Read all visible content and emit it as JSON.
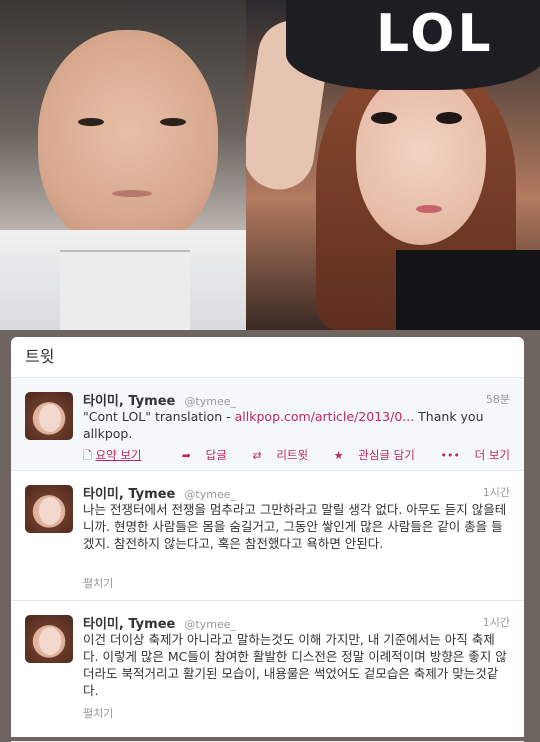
{
  "panel": {
    "title": "트윗"
  },
  "photos": {
    "cap_text": "LOL"
  },
  "tweets": [
    {
      "name": "타이미, Tymee",
      "handle": "@tymee_",
      "time": "58분",
      "text_before": "\"Cont LOL\" translation - ",
      "link": "allkpop.com/article/2013/0...",
      "text_after": " Thank you allkpop.",
      "summary": "요약 보기",
      "actions": {
        "reply": "답글",
        "retweet": "리트윗",
        "favorite": "관심글 담기",
        "more": "더 보기"
      }
    },
    {
      "name": "타이미, Tymee",
      "handle": "@tymee_",
      "time": "1시간",
      "text": "나는 전쟁터에서 전쟁을 멈추라고 그만하라고 말릴 생각 없다. 아무도 듣지 않을테니까. 현명한 사람들은 몸을 숨길거고, 그동안 쌓인게 많은 사람들은 같이 총을 들겠지. 참전하지 않는다고, 혹은 참전했다고 욕하면 안된다.",
      "fold": "펼치기"
    },
    {
      "name": "타이미, Tymee",
      "handle": "@tymee_",
      "time": "1시간",
      "text": "이건 더이상 축제가 아니라고 말하는것도 이해 가지만, 내 기준에서는 아직 축제다. 이렇게 많은 MC들이 참여한 활발한 디스전은 정말 이례적이며 방향은 좋지 않더라도 북적거리고 활기된 모습이, 내용물은 썩었어도 겉모습은 축제가 맞는것같다.",
      "fold": "펼치기"
    }
  ]
}
